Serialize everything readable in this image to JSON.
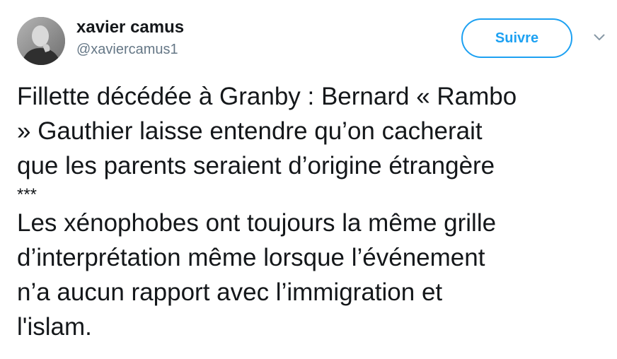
{
  "author": {
    "display_name": "xavier camus",
    "handle": "@xaviercamus1"
  },
  "actions": {
    "follow_label": "Suivre",
    "menu_icon": "chevron-down-icon"
  },
  "tweet": {
    "paragraph_1": "Fillette décédée à Granby : Bernard « Rambo\n» Gauthier laisse entendre qu’on cacherait\nque les parents seraient d’origine étrangère",
    "separator": "***",
    "paragraph_2": "Les xénophobes ont toujours la même grille\nd’interprétation même lorsque l’événement\nn’a aucun rapport avec l’immigration et\nl'islam."
  },
  "colors": {
    "accent": "#1da1f2",
    "text": "#14171a",
    "secondary_text": "#657786"
  }
}
